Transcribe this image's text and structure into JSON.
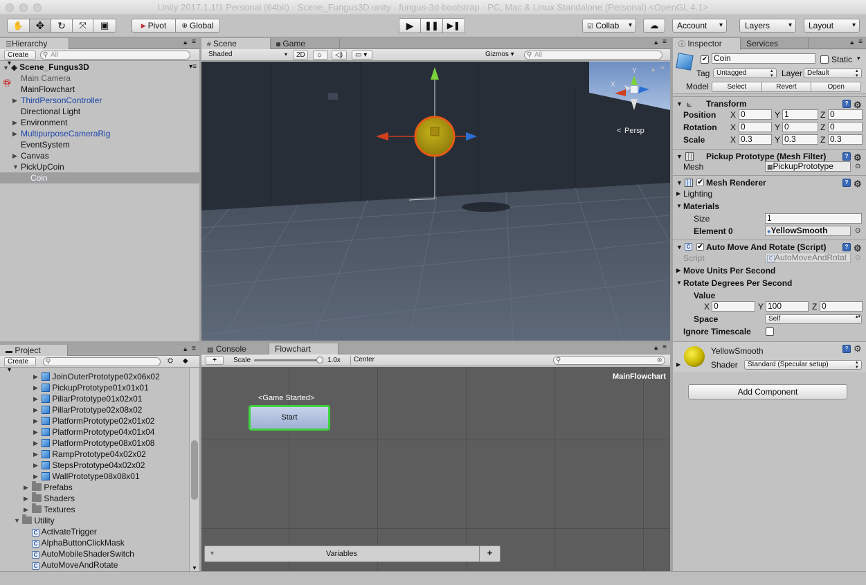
{
  "window": {
    "title": "Unity 2017.1.1f1 Personal (64bit) - Scene_Fungus3D.unity - fungus-3d-bootstrap - PC, Mac & Linux Standalone (Personal) <OpenGL 4.1>"
  },
  "toolbar": {
    "pivot": "Pivot",
    "global": "Global",
    "collab": "Collab",
    "account": "Account",
    "layers": "Layers",
    "layout": "Layout"
  },
  "hierarchy": {
    "tab": "Hierarchy",
    "create": "Create",
    "search_placeholder": "All",
    "scene": "Scene_Fungus3D",
    "items": [
      {
        "label": "Main Camera"
      },
      {
        "label": "MainFlowchart"
      },
      {
        "label": "ThirdPersonController"
      },
      {
        "label": "Directional Light"
      },
      {
        "label": "Environment"
      },
      {
        "label": "MultipurposeCameraRig"
      },
      {
        "label": "EventSystem"
      },
      {
        "label": "Canvas"
      },
      {
        "label": "PickUpCoin"
      },
      {
        "label": "Coin"
      }
    ]
  },
  "scene_view": {
    "tabs": [
      "Scene",
      "Game"
    ],
    "shading": "Shaded",
    "mode_2d": "2D",
    "gizmos": "Gizmos",
    "search_placeholder": "All",
    "persp": "Persp"
  },
  "project": {
    "tab": "Project",
    "create": "Create",
    "items": [
      {
        "label": "JoinOuterPrototype02x06x02"
      },
      {
        "label": "PickupPrototype01x01x01"
      },
      {
        "label": "PillarPrototype01x02x01"
      },
      {
        "label": "PillarPrototype02x08x02"
      },
      {
        "label": "PlatformPrototype02x01x02"
      },
      {
        "label": "PlatformPrototype04x01x04"
      },
      {
        "label": "PlatformPrototype08x01x08"
      },
      {
        "label": "RampPrototype04x02x02"
      },
      {
        "label": "StepsPrototype04x02x02"
      },
      {
        "label": "WallPrototype08x08x01"
      },
      {
        "label": "Prefabs"
      },
      {
        "label": "Shaders"
      },
      {
        "label": "Textures"
      },
      {
        "label": "Utility"
      },
      {
        "label": "ActivateTrigger"
      },
      {
        "label": "AlphaButtonClickMask"
      },
      {
        "label": "AutoMobileShaderSwitch"
      },
      {
        "label": "AutoMoveAndRotate"
      }
    ]
  },
  "flowchart": {
    "tabs": [
      "Console",
      "Flowchart"
    ],
    "add": "+",
    "scale_label": "Scale",
    "scale_value": "1.0x",
    "scale_fraction": 0.98,
    "center": "Center",
    "name": "MainFlowchart",
    "event_label": "<Game Started>",
    "block_label": "Start",
    "variables": "Variables"
  },
  "inspector": {
    "tabs": [
      "Inspector",
      "Services"
    ],
    "object_name": "Coin",
    "static_label": "Static",
    "tag_label": "Tag",
    "tag_value": "Untagged",
    "layer_label": "Layer",
    "layer_value": "Default",
    "model_label": "Model",
    "model_buttons": [
      "Select",
      "Revert",
      "Open"
    ],
    "transform": {
      "title": "Transform",
      "rows": [
        {
          "label": "Position",
          "x": "0",
          "y": "1",
          "z": "0"
        },
        {
          "label": "Rotation",
          "x": "0",
          "y": "0",
          "z": "0"
        },
        {
          "label": "Scale",
          "x": "0.3",
          "y": "0.3",
          "z": "0.3"
        }
      ]
    },
    "mesh_filter": {
      "title": "Pickup Prototype (Mesh Filter)",
      "mesh_label": "Mesh",
      "mesh_value": "PickupPrototype"
    },
    "mesh_renderer": {
      "title": "Mesh Renderer",
      "lighting": "Lighting",
      "materials": "Materials",
      "size_label": "Size",
      "size_value": "1",
      "element_label": "Element 0",
      "element_value": "YellowSmooth"
    },
    "auto_move": {
      "title": "Auto Move And Rotate (Script)",
      "script_label": "Script",
      "script_value": "AutoMoveAndRotat",
      "move_units": "Move Units Per Second",
      "rotate_degrees": "Rotate Degrees Per Second",
      "value_label": "Value",
      "x": "0",
      "y": "100",
      "z": "0",
      "space_label": "Space",
      "space_value": "Self",
      "ignore_timescale": "Ignore Timescale"
    },
    "material": {
      "name": "YellowSmooth",
      "shader_label": "Shader",
      "shader_value": "Standard (Specular setup)"
    },
    "add_component": "Add Component"
  },
  "axis_letters": {
    "x": "X",
    "y": "Y",
    "z": "Z"
  }
}
